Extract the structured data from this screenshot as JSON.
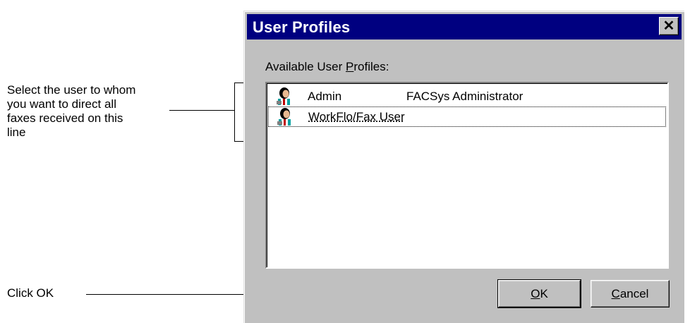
{
  "annotations": {
    "select_user_lines": [
      "Select the user to whom",
      "you want to direct all",
      "faxes received on this",
      "line"
    ],
    "click_ok": "Click OK"
  },
  "dialog": {
    "title": "User Profiles",
    "close_glyph": "✕",
    "list_label_prefix": "Available User ",
    "list_label_accel": "P",
    "list_label_suffix": "rofiles:",
    "profiles": [
      {
        "name": "Admin",
        "description": "FACSys Administrator",
        "icon": "user-profile-icon",
        "selected": false,
        "focused": false
      },
      {
        "name": "WorkFlo/Fax User",
        "description": "",
        "icon": "user-profile-icon",
        "selected": false,
        "focused": true
      }
    ],
    "ok_accel": "O",
    "ok_rest": "K",
    "cancel_accel": "C",
    "cancel_rest": "ancel"
  },
  "colors": {
    "titlebar": "#000080",
    "face": "#c0c0c0"
  }
}
